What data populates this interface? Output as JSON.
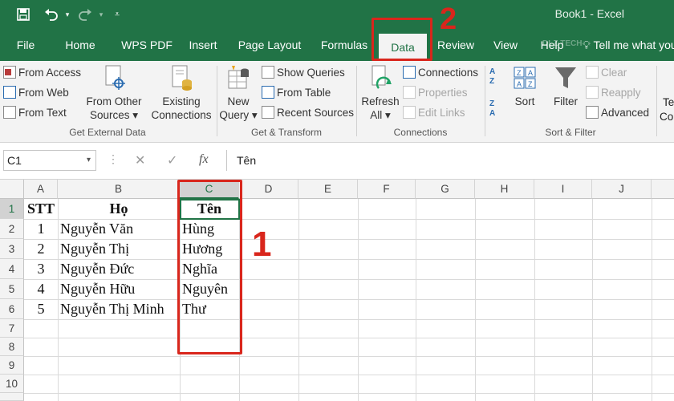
{
  "titlebar": {
    "title": "Book1  -  Excel",
    "save_icon": "save-icon",
    "undo_icon": "undo-icon",
    "redo_icon": "redo-icon",
    "customize_icon": "customize-qat-icon"
  },
  "tabs": [
    "File",
    "Home",
    "WPS PDF",
    "Insert",
    "Page Layout",
    "Formulas",
    "Data",
    "Review",
    "View",
    "Help"
  ],
  "active_tab": "Data",
  "tell_me": "Tell me what you",
  "watermark": "DLZ TECH",
  "ribbon": {
    "get_external_data": {
      "label": "Get External Data",
      "from_access": "From Access",
      "from_web": "From Web",
      "from_text": "From Text",
      "from_other_1": "From Other",
      "from_other_2": "Sources ▾",
      "existing_1": "Existing",
      "existing_2": "Connections"
    },
    "get_transform": {
      "label": "Get & Transform",
      "new_query_1": "New",
      "new_query_2": "Query ▾",
      "show_queries": "Show Queries",
      "from_table": "From Table",
      "recent_sources": "Recent Sources"
    },
    "connections": {
      "label": "Connections",
      "refresh_1": "Refresh",
      "refresh_2": "All ▾",
      "connections": "Connections",
      "properties": "Properties",
      "edit_links": "Edit Links"
    },
    "sort_filter": {
      "label": "Sort & Filter",
      "sort": "Sort",
      "filter": "Filter",
      "clear": "Clear",
      "reapply": "Reapply",
      "advanced": "Advanced"
    },
    "cutoff_1": "Te",
    "cutoff_2": "Co"
  },
  "formula_bar": {
    "name_box": "C1",
    "cancel": "✕",
    "enter": "✓",
    "fx": "fx",
    "formula": "Tên"
  },
  "columns": [
    "A",
    "B",
    "C",
    "D",
    "E",
    "F",
    "G",
    "H",
    "I",
    "J"
  ],
  "rows": [
    "1",
    "2",
    "3",
    "4",
    "5",
    "6",
    "7",
    "8",
    "9",
    "10"
  ],
  "sheet": {
    "header": [
      "STT",
      "Họ",
      "Tên"
    ],
    "data": [
      [
        "1",
        "Nguyễn Văn",
        "Hùng"
      ],
      [
        "2",
        "Nguyễn Thị",
        "Hương"
      ],
      [
        "3",
        "Nguyễn Đức",
        "Nghĩa"
      ],
      [
        "4",
        "Nguyễn Hữu",
        "Nguyên"
      ],
      [
        "5",
        "Nguyễn Thị Minh",
        "Thư"
      ]
    ]
  },
  "annotations": {
    "step1": "1",
    "step2": "2",
    "color": "#d9261c"
  },
  "colors": {
    "brand": "#217346",
    "ribbon": "#f3f3f3"
  }
}
